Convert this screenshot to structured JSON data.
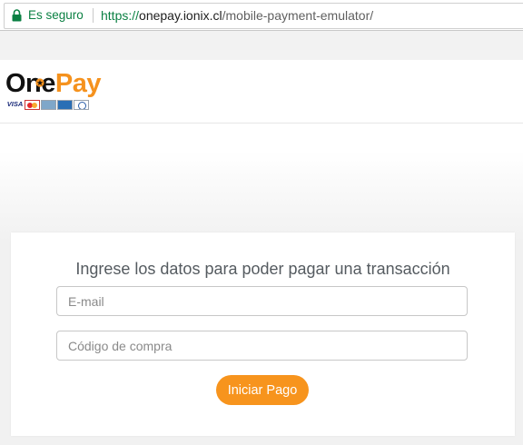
{
  "browser": {
    "security_label": "Es seguro",
    "url_scheme": "https://",
    "url_host": "onepay.ionix.cl",
    "url_path": "/mobile-payment-emulator/"
  },
  "header": {
    "logo_part1": "One",
    "logo_part2": "Pay",
    "cards": [
      "VISA",
      "mastercard",
      "american-express-card",
      "amex",
      "diners-club"
    ]
  },
  "form": {
    "title": "Ingrese los datos para poder pagar una transacción",
    "email_placeholder": "E-mail",
    "email_value": "",
    "code_placeholder": "Código de compra",
    "code_value": "",
    "submit_label": "Iniciar Pago"
  },
  "colors": {
    "accent": "#f7941d",
    "secure_green": "#0b8043"
  }
}
